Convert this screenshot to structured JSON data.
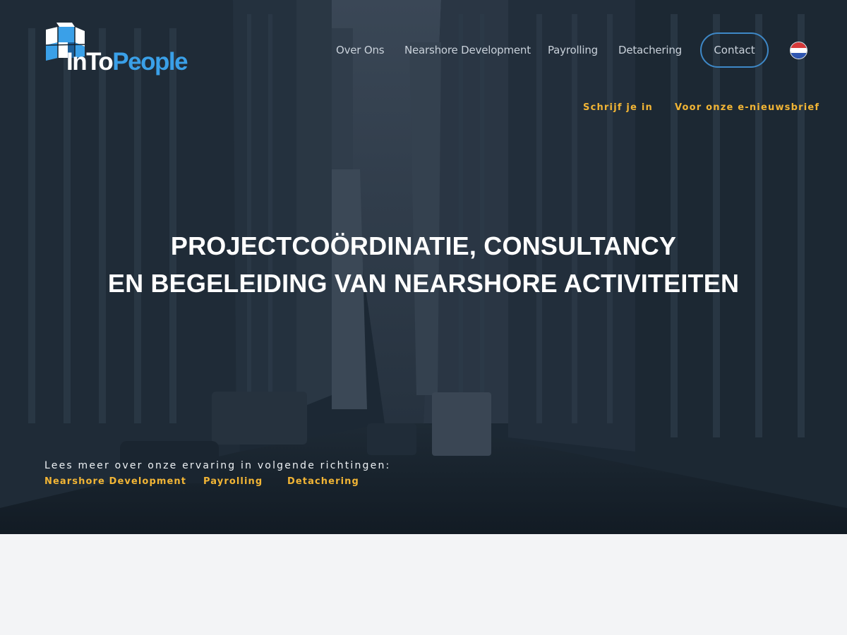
{
  "brand": {
    "name_part1": "In",
    "name_part2": "To",
    "name_part3": "People",
    "accent": "#3aa0e8",
    "icon": "cube-logo-icon"
  },
  "nav": {
    "items": [
      {
        "label": "Over Ons"
      },
      {
        "label": "Nearshore Development"
      },
      {
        "label": "Payrolling"
      },
      {
        "label": "Detachering"
      }
    ],
    "contact_label": "Contact",
    "language_icon": "dutch-flag-icon"
  },
  "newsletter": {
    "signup": "Schrijf je in",
    "description": "Voor onze e-nieuwsbrief"
  },
  "hero": {
    "headline_line1": "PROJECTCOÖRDINATIE, CONSULTANCY",
    "headline_line2": "EN BEGELEIDING VAN NEARSHORE ACTIVITEITEN"
  },
  "read_more": {
    "intro": "Lees meer over onze ervaring in volgende richtingen:",
    "links": [
      {
        "label": "Nearshore Development"
      },
      {
        "label": "Payrolling"
      },
      {
        "label": "Detachering"
      }
    ]
  },
  "colors": {
    "link_yellow": "#f2b535",
    "contact_border": "#3e88c7",
    "hero_overlay": "#1a2733"
  }
}
